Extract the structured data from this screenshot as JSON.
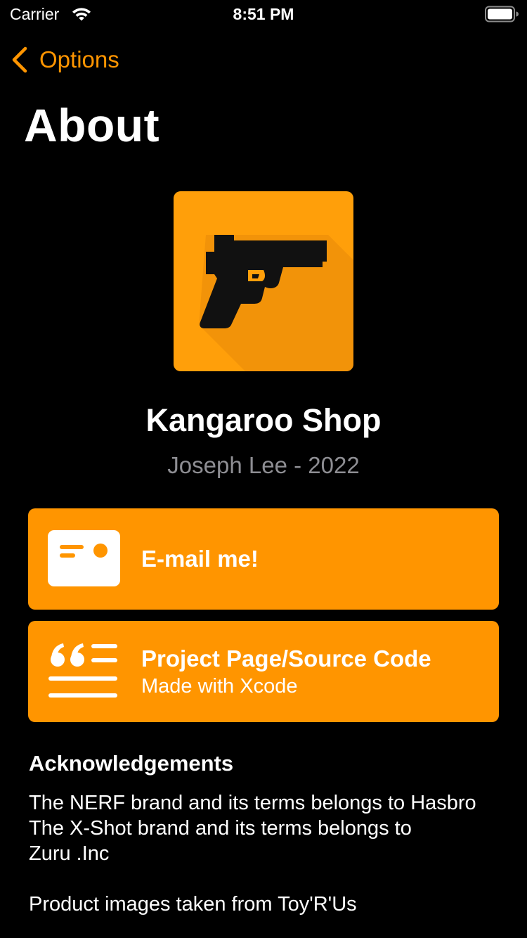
{
  "status_bar": {
    "carrier": "Carrier",
    "time": "8:51 PM",
    "wifi_icon": "wifi-icon",
    "battery_icon": "battery-icon"
  },
  "nav": {
    "back_label": "Options",
    "back_icon": "chevron-left-icon"
  },
  "page": {
    "title": "About"
  },
  "app": {
    "icon": "pistol-app-icon",
    "name": "Kangaroo Shop",
    "author": "Joseph Lee - 2022"
  },
  "actions": {
    "email": {
      "label": "E-mail me!",
      "icon": "contact-card-icon"
    },
    "project": {
      "label": "Project Page/Source Code",
      "subtitle": "Made with Xcode",
      "icon": "quote-text-icon"
    }
  },
  "acknowledgements": {
    "heading": "Acknowledgements",
    "lines": [
      "The NERF brand and its terms belongs to Hasbro",
      "The X-Shot brand and its terms belongs to",
      "Zuru .Inc",
      "Product images taken from Toy'R'Us"
    ]
  },
  "colors": {
    "accent": "#ff9500",
    "background": "#000000",
    "secondary_text": "#8e8e93"
  }
}
